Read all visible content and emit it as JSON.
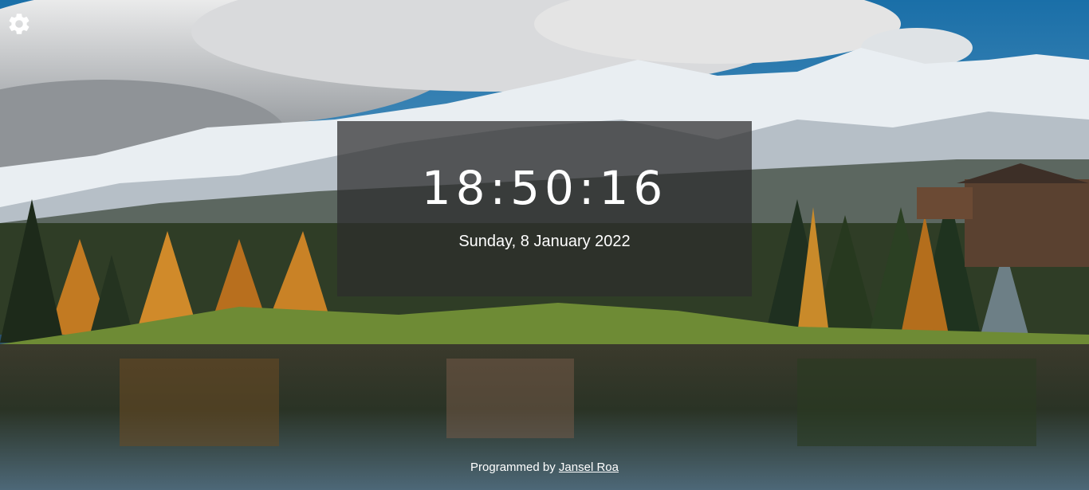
{
  "settings": {
    "icon": "gear-icon"
  },
  "clock": {
    "time": "18:50:16",
    "date": "Sunday, 8 January 2022"
  },
  "footer": {
    "prefix": "Programmed by",
    "author_link": "Jansel Roa"
  },
  "colors": {
    "sky": "#1e6fa0",
    "panel": "#2d2d2d",
    "text": "#ffffff"
  }
}
